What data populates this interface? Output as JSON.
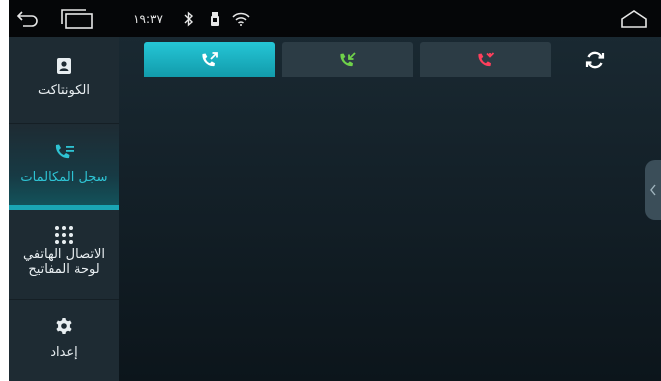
{
  "status_bar": {
    "time": "١٩:٣٧",
    "icons": [
      "back-icon",
      "recent-apps-icon",
      "bluetooth-icon",
      "usb-icon",
      "wifi-icon",
      "home-icon"
    ]
  },
  "sidebar": {
    "items": [
      {
        "label": "الكونتاكت",
        "icon": "contacts-icon"
      },
      {
        "label": "سجل المكالمات",
        "icon": "call-log-icon",
        "active": true
      },
      {
        "label": "الاتصال الهاتفي لوحة المفاتيح",
        "line1": "الاتصال الهاتفي",
        "line2": "لوحة المفاتيح",
        "icon": "dialpad-icon"
      },
      {
        "label": "إعداد",
        "icon": "settings-icon"
      }
    ]
  },
  "tabs": [
    {
      "name": "outgoing-calls",
      "icon": "outgoing-call-icon",
      "color": "#ffffff",
      "active": true
    },
    {
      "name": "incoming-calls",
      "icon": "incoming-call-icon",
      "color": "#6fd24a"
    },
    {
      "name": "missed-calls",
      "icon": "missed-call-icon",
      "color": "#ff3f5c"
    }
  ],
  "toolbar": {
    "refresh_icon": "refresh-icon"
  },
  "colors": {
    "accent": "#1aa6b5",
    "incoming": "#6fd24a",
    "missed": "#ff3f5c"
  }
}
